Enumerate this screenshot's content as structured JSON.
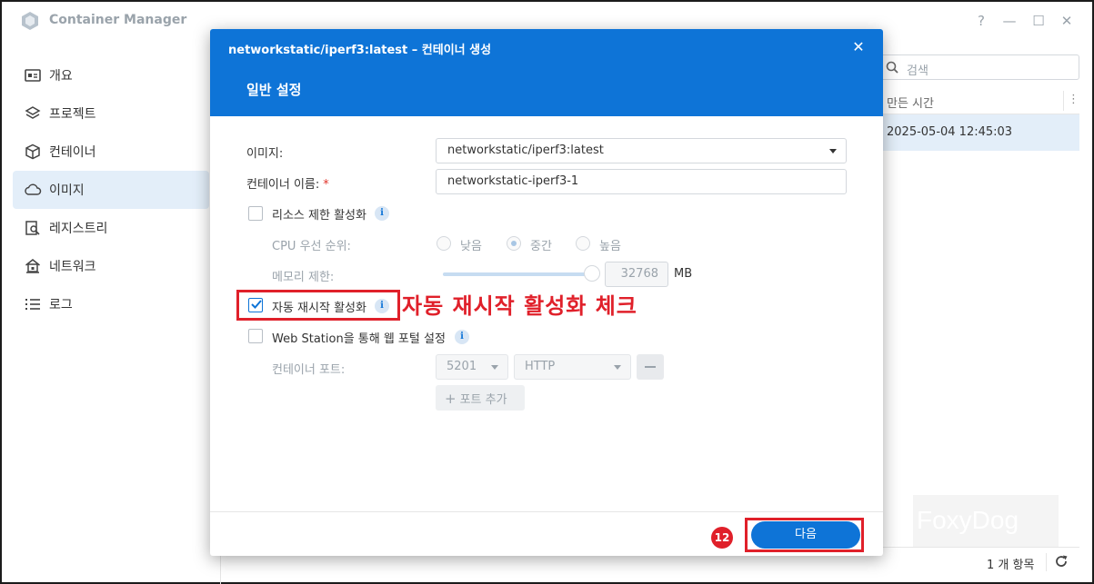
{
  "app": {
    "title": "Container Manager",
    "window_controls": [
      "?",
      "—",
      "☐",
      "✕"
    ]
  },
  "sidebar": {
    "items": [
      {
        "label": "개요",
        "icon": "overview-icon",
        "active": false
      },
      {
        "label": "프로젝트",
        "icon": "layers-icon",
        "active": false
      },
      {
        "label": "컨테이너",
        "icon": "cube-icon",
        "active": false
      },
      {
        "label": "이미지",
        "icon": "cloud-icon",
        "active": true
      },
      {
        "label": "레지스트리",
        "icon": "registry-search-icon",
        "active": false
      },
      {
        "label": "네트워크",
        "icon": "network-home-icon",
        "active": false
      },
      {
        "label": "로그",
        "icon": "list-icon",
        "active": false
      }
    ]
  },
  "main": {
    "search_placeholder": "검색",
    "column_header": "만든 시간",
    "rows": [
      {
        "created": "2025-05-04 12:45:03"
      }
    ],
    "item_count": "1 개 항목"
  },
  "watermark": "FoxyDog",
  "dialog": {
    "title": "networkstatic/iperf3:latest – 컨테이너 생성",
    "subtitle": "일반 설정",
    "image_label": "이미지:",
    "image_value": "networkstatic/iperf3:latest",
    "container_name_label": "컨테이너 이름:",
    "required_mark": "*",
    "container_name_value": "networkstatic-iperf3-1",
    "resource_limit_label": "리소스 제한 활성화",
    "cpu_priority_label": "CPU 우선 순위:",
    "cpu_options": [
      "낮음",
      "중간",
      "높음"
    ],
    "cpu_selected": "중간",
    "memory_limit_label": "메모리 제한:",
    "memory_value": "32768",
    "memory_unit": "MB",
    "auto_restart_label": "자동 재시작 활성화",
    "auto_restart_checked": true,
    "web_station_label": "Web Station을 통해 웹 포털 설정",
    "container_port_label": "컨테이너 포트:",
    "port_value": "5201",
    "protocol_value": "HTTP",
    "add_port_label": "포트 추가",
    "next_button": "다음"
  },
  "annotations": {
    "auto_restart_note": "자동 재시작 활성화 체크",
    "step_badge": "12",
    "color": "#e0202a"
  },
  "colors": {
    "accent": "#0e74d7",
    "selected_bg": "#e3eef9"
  }
}
